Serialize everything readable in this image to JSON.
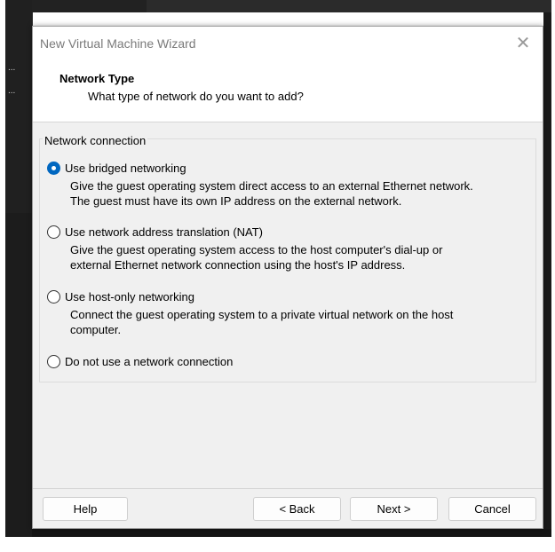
{
  "background": {
    "ellipsis_1": "...",
    "ellipsis_2": "..."
  },
  "dialog": {
    "title": "New Virtual Machine Wizard",
    "close_glyph": "✕",
    "header_title": "Network Type",
    "header_subtitle": "What type of network do you want to add?",
    "group_label": "Network connection",
    "options": [
      {
        "label": "Use bridged networking",
        "checked": true,
        "desc_lines": [
          "Give the guest operating system direct access to an external Ethernet network.",
          "The guest must have its own IP address on the external network."
        ]
      },
      {
        "label": "Use network address translation (NAT)",
        "checked": false,
        "desc_lines": [
          "Give the guest operating system access to the host computer's dial-up or",
          "external Ethernet network connection using the host's IP address."
        ]
      },
      {
        "label": "Use host-only networking",
        "checked": false,
        "desc_lines": [
          "Connect the guest operating system to a private virtual network on the host",
          "computer."
        ]
      },
      {
        "label": "Do not use a network connection",
        "checked": false,
        "desc_lines": []
      }
    ],
    "buttons": {
      "help": "Help",
      "back": "< Back",
      "next": "Next >",
      "cancel": "Cancel"
    },
    "accent_color": "#0067c0"
  }
}
